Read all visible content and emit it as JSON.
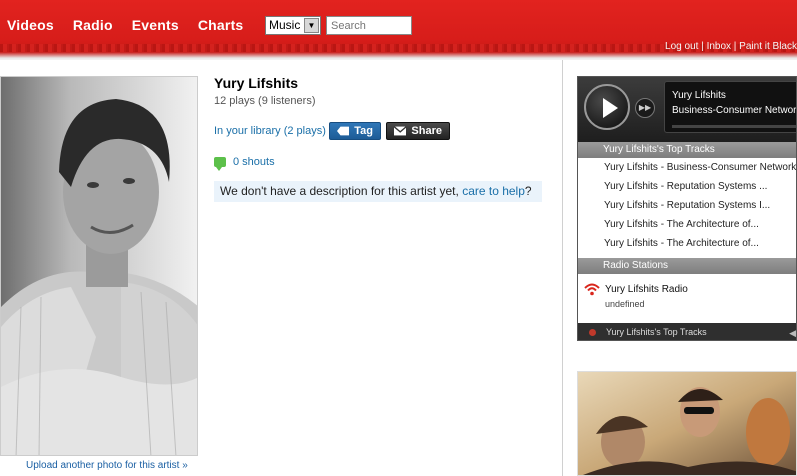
{
  "header": {
    "nav": [
      "Videos",
      "Radio",
      "Events",
      "Charts"
    ],
    "search_scope": "Music",
    "search_placeholder": "Search",
    "user_links": "Log out | Inbox | Paint it Black"
  },
  "artist": {
    "name": "Yury Lifshits",
    "stats": "12 plays (9 listeners)",
    "library": "In your library (2 plays)",
    "tag_label": "Tag",
    "share_label": "Share",
    "shouts": "0 shouts",
    "description_text": "We don't have a description for this artist yet, ",
    "description_link": "care to help",
    "description_end": "?",
    "upload_link": "Upload another photo for this artist »"
  },
  "player": {
    "now_playing_artist": "Yury Lifshits",
    "now_playing_track": "Business-Consumer Network",
    "top_tracks_heading": "Yury Lifshits's Top Tracks",
    "tracks": [
      "Yury Lifshits - Business-Consumer Network",
      "Yury Lifshits - Reputation Systems ...",
      "Yury Lifshits - Reputation Systems I...",
      "Yury Lifshits - The Architecture of...",
      "Yury Lifshits - The Architecture of..."
    ],
    "radio_heading": "Radio Stations",
    "radio_title": "Yury Lifshits Radio",
    "radio_sub": "undefined",
    "footer": "Yury Lifshits's Top Tracks"
  },
  "colors": {
    "brand_red": "#d71d1a",
    "link_blue": "#1a6fa8",
    "tag_blue": "#2f77b8"
  }
}
